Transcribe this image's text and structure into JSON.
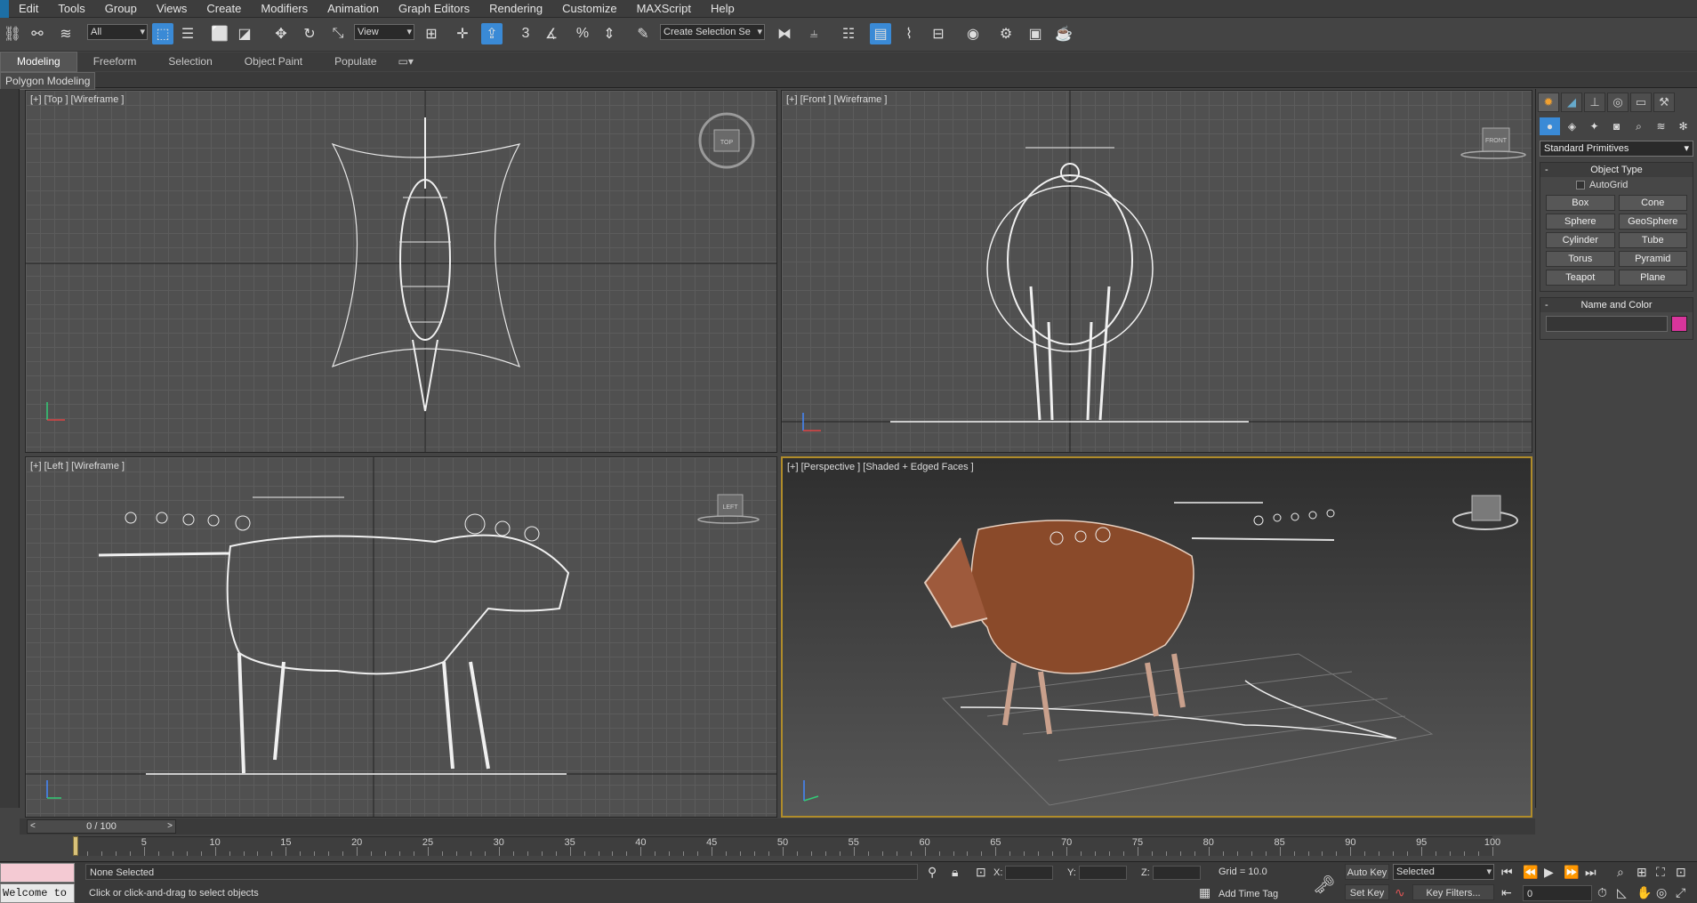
{
  "menu": [
    "Edit",
    "Tools",
    "Group",
    "Views",
    "Create",
    "Modifiers",
    "Animation",
    "Graph Editors",
    "Rendering",
    "Customize",
    "MAXScript",
    "Help"
  ],
  "toolbar": {
    "filter_value": "All",
    "refcoord_value": "View",
    "named_selection_value": "Create Selection Se",
    "snap_labels": [
      "3",
      "%"
    ]
  },
  "ribbon": {
    "tabs": [
      "Modeling",
      "Freeform",
      "Selection",
      "Object Paint",
      "Populate"
    ]
  },
  "subribbon": {
    "label": "Polygon Modeling"
  },
  "viewports": {
    "top": "[+] [Top ] [Wireframe ]",
    "front": "[+] [Front ] [Wireframe ]",
    "left": "[+] [Left ] [Wireframe ]",
    "perspective": "[+] [Perspective ] [Shaded + Edged Faces ]"
  },
  "viewcube": {
    "top": "TOP",
    "front": "FRONT",
    "left": "LEFT"
  },
  "command_panel": {
    "category": "Standard Primitives",
    "object_type_title": "Object Type",
    "autogrid_label": "AutoGrid",
    "primitives": [
      "Box",
      "Cone",
      "Sphere",
      "GeoSphere",
      "Cylinder",
      "Tube",
      "Torus",
      "Pyramid",
      "Teapot",
      "Plane"
    ],
    "name_color_title": "Name and Color",
    "object_color": "#d8359b"
  },
  "timeline": {
    "slider_label": "0 / 100",
    "ticks": [
      "5",
      "10",
      "15",
      "20",
      "25",
      "30",
      "35",
      "40",
      "45",
      "50",
      "55",
      "60",
      "65",
      "70",
      "75",
      "80",
      "85",
      "90",
      "95",
      "100"
    ]
  },
  "status": {
    "maxscript_text": "Welcome to M",
    "selection": "None Selected",
    "prompt": "Click or click-and-drag to select objects",
    "x_label": "X:",
    "y_label": "Y:",
    "z_label": "Z:",
    "grid": "Grid = 10.0",
    "add_time_tag": "Add Time Tag",
    "auto_key": "Auto Key",
    "set_key": "Set Key",
    "key_mode_value": "Selected",
    "key_filters": "Key Filters...",
    "frame_value": "0"
  }
}
